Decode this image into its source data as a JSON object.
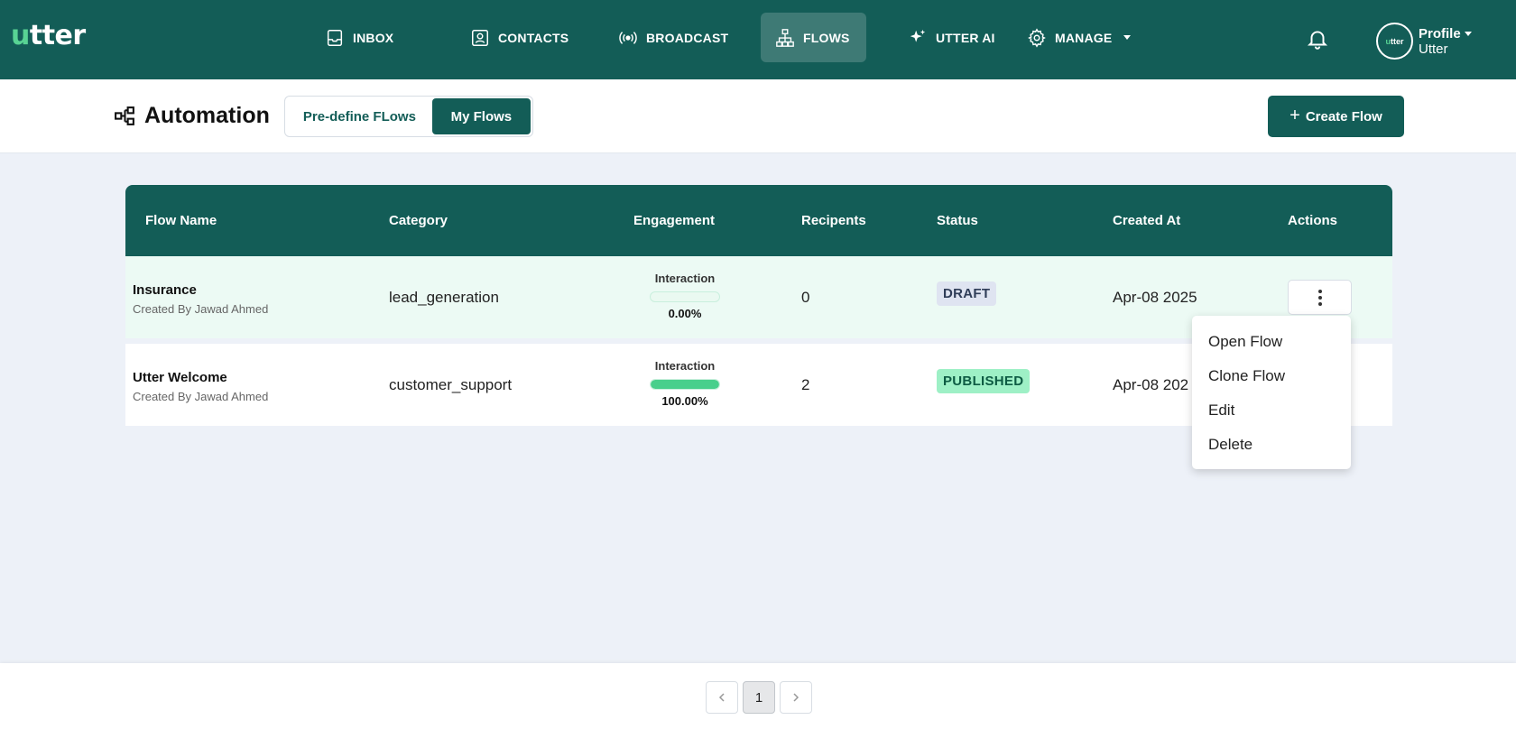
{
  "app": {
    "logo_accent": "u",
    "logo_rest": "tter"
  },
  "nav": {
    "items": [
      {
        "label": "INBOX",
        "icon": "inbox-icon"
      },
      {
        "label": "CONTACTS",
        "icon": "contacts-icon"
      },
      {
        "label": "BROADCAST",
        "icon": "broadcast-icon"
      },
      {
        "label": "FLOWS",
        "icon": "flows-icon",
        "active": true
      },
      {
        "label": "UTTER AI",
        "icon": "sparkle-icon"
      },
      {
        "label": "MANAGE",
        "icon": "gear-icon"
      }
    ],
    "profile": {
      "title": "Profile",
      "subtitle": "Utter",
      "avatar_accent": "u",
      "avatar_rest": "tter"
    }
  },
  "header": {
    "title": "Automation",
    "tabs": {
      "predefined": "Pre-define FLows",
      "my": "My Flows",
      "selected": "My Flows"
    },
    "create_button": "Create Flow"
  },
  "table": {
    "columns": [
      "Flow Name",
      "Category",
      "Engagement",
      "Recipents",
      "Status",
      "Created At",
      "Actions"
    ],
    "rows": [
      {
        "name": "Insurance",
        "created_by": "Created By Jawad Ahmed",
        "category": "lead_generation",
        "engagement_label": "Interaction",
        "engagement_value": "0.00%",
        "engagement_fraction": 0.0,
        "recipients": "0",
        "status": "DRAFT",
        "created_at": "Apr-08 2025"
      },
      {
        "name": "Utter Welcome",
        "created_by": "Created By Jawad Ahmed",
        "category": "customer_support",
        "engagement_label": "Interaction",
        "engagement_value": "100.00%",
        "engagement_fraction": 1.0,
        "recipients": "2",
        "status": "PUBLISHED",
        "created_at": "Apr-08 202"
      }
    ]
  },
  "actions_menu": {
    "items": [
      "Open Flow",
      "Clone Flow",
      "Edit",
      "Delete"
    ]
  },
  "pagination": {
    "current": "1"
  },
  "colors": {
    "primary": "#135d57",
    "accent_green": "#48cf8c",
    "published_bg": "#9ef0c6",
    "draft_bg": "#dfe4f1",
    "row_highlight": "#ecfaf4",
    "page_bg": "#edf1f8"
  }
}
